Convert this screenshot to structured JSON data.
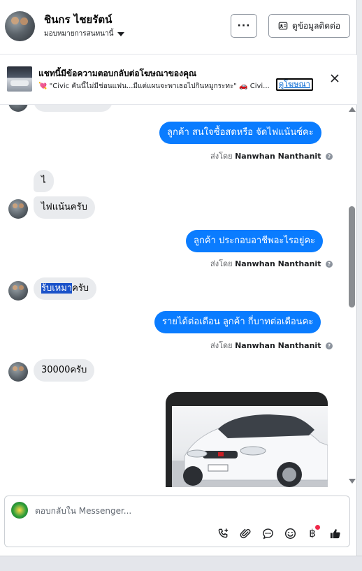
{
  "header": {
    "contact_name": "ชินกร ไชยรัตน์",
    "assign_label": "มอบหมายการสนทนานี้",
    "more_label": "···",
    "contact_info_label": "ดูข้อมูลติดต่อ"
  },
  "ad": {
    "title": "แชทนี้มีข้อความตอบกลับต่อโฆษณาของคุณ",
    "snippet": "💘 \"Civic คันนี้ไม่มีช่อนแฟน...มีแต่แผนจะพาเธอไปกินหมูกระทะ\" 🚗 Civi...",
    "link_label": "ดูโฆษณา"
  },
  "messages": [
    {
      "dir": "in",
      "text": "ไ"
    },
    {
      "dir": "in",
      "text": "ไฟแน้นครับ"
    },
    {
      "dir": "out",
      "text": "ลูกค้า สนใจซื้อสดหรือ จัดไฟแน้นซ์คะ"
    },
    {
      "dir": "out",
      "text": "ลูกค้า ประกอบอาชีพอะไรอยู่คะ"
    },
    {
      "dir": "in",
      "text_selected": "รับเหมา",
      "text_rest": "ครับ"
    },
    {
      "dir": "out",
      "text": "รายได้ต่อเดือน ลูกค้า กี่บาทต่อเดือนคะ"
    },
    {
      "dir": "in",
      "text": "30000ครับ"
    }
  ],
  "sent_by": {
    "prefix": "ส่งโดย",
    "agent": "Nanwhan Nanthanit",
    "info_glyph": "?"
  },
  "composer": {
    "placeholder": "ตอบกลับใน Messenger...",
    "baht_glyph": "฿"
  },
  "colors": {
    "outgoing_bubble": "#0a7cff",
    "incoming_bubble": "#e9ebee",
    "notification_dot": "#f02849"
  }
}
